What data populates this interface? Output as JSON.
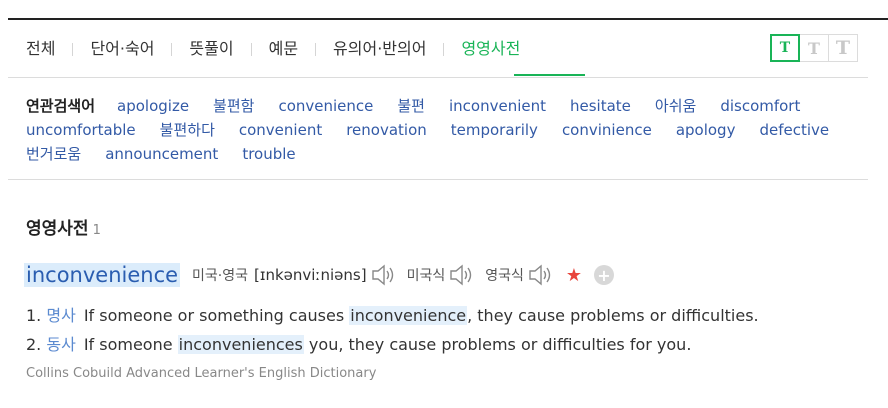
{
  "tabs": [
    {
      "label": "전체"
    },
    {
      "label": "단어·숙어"
    },
    {
      "label": "뜻풀이"
    },
    {
      "label": "예문"
    },
    {
      "label": "유의어·반의어"
    },
    {
      "label": "영영사전",
      "active": true
    }
  ],
  "font_size_buttons": [
    "T",
    "T",
    "T"
  ],
  "related": {
    "label": "연관검색어",
    "words": [
      "apologize",
      "불편함",
      "convenience",
      "불편",
      "inconvenient",
      "hesitate",
      "아쉬움",
      "discomfort",
      "uncomfortable",
      "불편하다",
      "convenient",
      "renovation",
      "temporarily",
      "convinience",
      "apology",
      "defective",
      "번거로움",
      "announcement",
      "trouble"
    ]
  },
  "section": {
    "title": "영영사전",
    "count": "1"
  },
  "entry": {
    "headword": "inconvenience",
    "pron_label": "미국·영국",
    "pron": "[ɪnkənviːniəns]",
    "us_label": "미국식",
    "uk_label": "영국식",
    "star": "★",
    "plus": "+",
    "senses": [
      {
        "num": "1.",
        "pos": "명사",
        "before": "If someone or something causes ",
        "highlight": "inconvenience",
        "after": ", they cause problems or difficulties."
      },
      {
        "num": "2.",
        "pos": "동사",
        "before": "If someone ",
        "highlight": "inconveniences",
        "after": " you, they cause problems or difficulties for you."
      }
    ],
    "source": "Collins Cobuild Advanced Learner's English Dictionary"
  },
  "colors": {
    "accent": "#19b457",
    "link": "#335aa6",
    "star": "#e8453c"
  },
  "icons": [
    "speaker-icon",
    "star-icon",
    "plus-icon"
  ]
}
